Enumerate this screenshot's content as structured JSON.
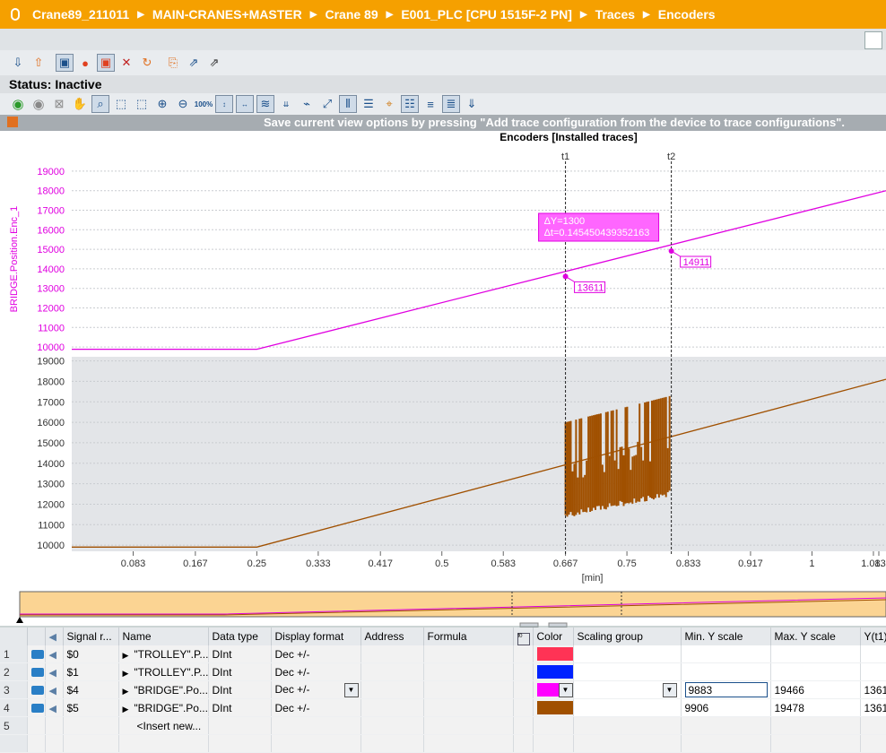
{
  "breadcrumb": [
    "Crane89_211011",
    "MAIN-CRANES+MASTER",
    "Crane 89",
    "E001_PLC [CPU 1515F-2 PN]",
    "Traces",
    "Encoders"
  ],
  "status": {
    "label": "Status:",
    "value": "Inactive"
  },
  "infobar": {
    "text": "Save current view options by pressing \"Add trace configuration from the device to trace configurations\"."
  },
  "chart_data": {
    "type": "line",
    "title": "Encoders [Installed traces]",
    "xlabel": "[min]",
    "x_ticks": [
      "0.083",
      "0.167",
      "0.25",
      "0.333",
      "0.417",
      "0.5",
      "0.583",
      "0.667",
      "0.75",
      "0.833",
      "0.917",
      "1",
      "1.083",
      "1."
    ],
    "xlim": [
      0.0,
      1.1
    ],
    "panels": [
      {
        "ylabel": "BRIDGE.Position.Enc_1",
        "ylim": [
          9500,
          19500
        ],
        "y_ticks": [
          "10000",
          "11000",
          "12000",
          "13000",
          "14000",
          "15000",
          "16000",
          "17000",
          "18000",
          "19000"
        ],
        "series": [
          {
            "name": "BRIDGE.Position.Enc_1",
            "color": "#e000e0",
            "x": [
              0.0,
              0.25,
              1.1
            ],
            "y": [
              9883,
              9883,
              18000
            ]
          }
        ]
      },
      {
        "ylabel": "",
        "ylim": [
          9700,
          19200
        ],
        "y_ticks": [
          "10000",
          "11000",
          "12000",
          "13000",
          "14000",
          "15000",
          "16000",
          "17000",
          "18000",
          "19000"
        ],
        "series": [
          {
            "color": "#a05000",
            "x": [
              0.0,
              0.25,
              1.1
            ],
            "y": [
              9906,
              9906,
              18100
            ]
          }
        ],
        "noise": {
          "x_range": [
            0.667,
            0.81
          ],
          "y_low": [
            11300,
            12400
          ],
          "y_high": [
            16000,
            17300
          ]
        }
      }
    ],
    "cursors": [
      {
        "label": "t1",
        "x": 0.667,
        "value": "13611"
      },
      {
        "label": "t2",
        "x": 0.81,
        "value": "14911"
      }
    ],
    "delta_box": [
      "ΔY=1300",
      "Δt=0.145450439352163"
    ]
  },
  "table": {
    "headers": [
      "Signal r...",
      "Name",
      "Data type",
      "Display format",
      "Address",
      "Formula",
      "Color",
      "Scaling group",
      "Min. Y scale",
      "Max. Y scale",
      "Y(t1)"
    ],
    "rows": [
      {
        "num": "1",
        "signal": "$0",
        "name": "\"TROLLEY\".P...",
        "type": "DInt",
        "format": "Dec +/-",
        "color": "#ff3355",
        "min": "",
        "max": "",
        "yt1": ""
      },
      {
        "num": "2",
        "signal": "$1",
        "name": "\"TROLLEY\".P...",
        "type": "DInt",
        "format": "Dec +/-",
        "color": "#0022ff",
        "min": "",
        "max": "",
        "yt1": ""
      },
      {
        "num": "3",
        "signal": "$4",
        "name": "\"BRIDGE\".Po...",
        "type": "DInt",
        "format": "Dec +/-",
        "color": "#ff00ff",
        "min": "9883",
        "max": "19466",
        "yt1": "1361"
      },
      {
        "num": "4",
        "signal": "$5",
        "name": "\"BRIDGE\".Po...",
        "type": "DInt",
        "format": "Dec +/-",
        "color": "#a05000",
        "min": "9906",
        "max": "19478",
        "yt1": "1361"
      }
    ],
    "insert": {
      "num": "5",
      "label": "<Insert new..."
    }
  }
}
